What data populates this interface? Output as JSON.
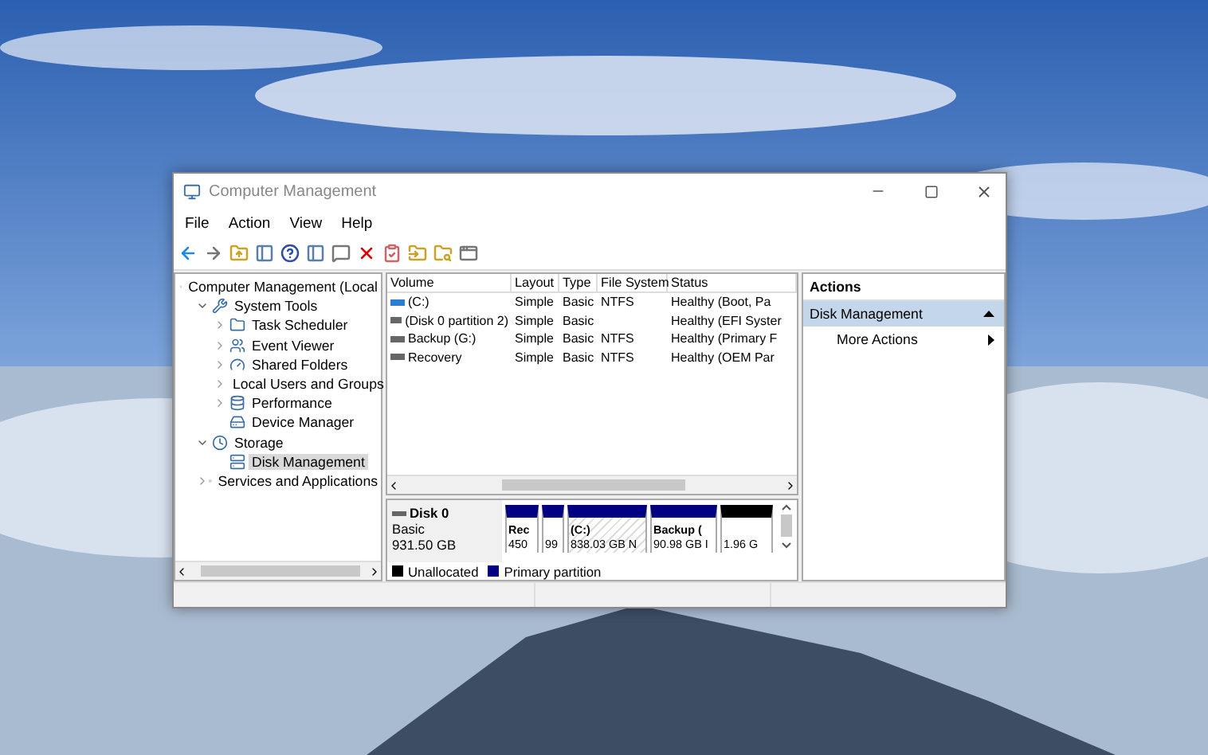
{
  "window": {
    "title": "Computer Management"
  },
  "menu": [
    "File",
    "Action",
    "View",
    "Help"
  ],
  "tree": [
    {
      "label": "Computer Management (Local",
      "selected": false,
      "children": [
        {
          "label": "System Tools",
          "expanded": true,
          "selected": false,
          "children": [
            {
              "label": "Task Scheduler",
              "expanded": false,
              "selected": false
            },
            {
              "label": "Event Viewer",
              "expanded": false,
              "selected": false
            },
            {
              "label": "Shared Folders",
              "expanded": false,
              "selected": false
            },
            {
              "label": "Local Users and Groups",
              "expanded": false,
              "selected": false
            },
            {
              "label": "Performance",
              "expanded": false,
              "selected": false
            },
            {
              "label": "Device Manager",
              "selected": false
            }
          ]
        },
        {
          "label": "Storage",
          "expanded": true,
          "selected": false,
          "children": [
            {
              "label": "Disk Management",
              "selected": true
            }
          ]
        },
        {
          "label": "Services and Applications",
          "expanded": false,
          "selected": false
        }
      ]
    }
  ],
  "table": {
    "columns": [
      "Volume",
      "Layout",
      "Type",
      "File System",
      "Status"
    ],
    "rows": [
      {
        "cells": [
          "(C:)",
          "Simple",
          "Basic",
          "NTFS",
          "Healthy (Boot, Pa"
        ],
        "color": "#2a7fd4"
      },
      {
        "cells": [
          "(Disk 0 partition 2)",
          "Simple",
          "Basic",
          "",
          "Healthy (EFI Syster"
        ],
        "color": "#666666"
      },
      {
        "cells": [
          "Backup (G:)",
          "Simple",
          "Basic",
          "NTFS",
          "Healthy (Primary F"
        ],
        "color": "#666666"
      },
      {
        "cells": [
          "Recovery",
          "Simple",
          "Basic",
          "NTFS",
          "Healthy (OEM Par"
        ],
        "color": "#666666"
      }
    ]
  },
  "disk": {
    "name": "Disk 0",
    "type": "Basic",
    "size": "931.50 GB",
    "partitions": [
      {
        "kind": "primary",
        "name": "Rec",
        "detail": "450",
        "selected": false
      },
      {
        "kind": "primary",
        "detail": "99",
        "selected": false
      },
      {
        "kind": "primary",
        "name": "(C:)",
        "detail": "838.03 GB N",
        "selected": true
      },
      {
        "kind": "primary",
        "name": "Backup (",
        "detail": "90.98 GB I",
        "selected": false
      },
      {
        "kind": "unallocated",
        "detail": "1.96 G",
        "selected": false
      }
    ],
    "legend": [
      {
        "label": "Unallocated",
        "color": "#000000"
      },
      {
        "label": "Primary partition",
        "color": "#000080"
      }
    ]
  },
  "actions": {
    "title": "Actions",
    "section": "Disk Management",
    "items": [
      "More Actions"
    ]
  }
}
